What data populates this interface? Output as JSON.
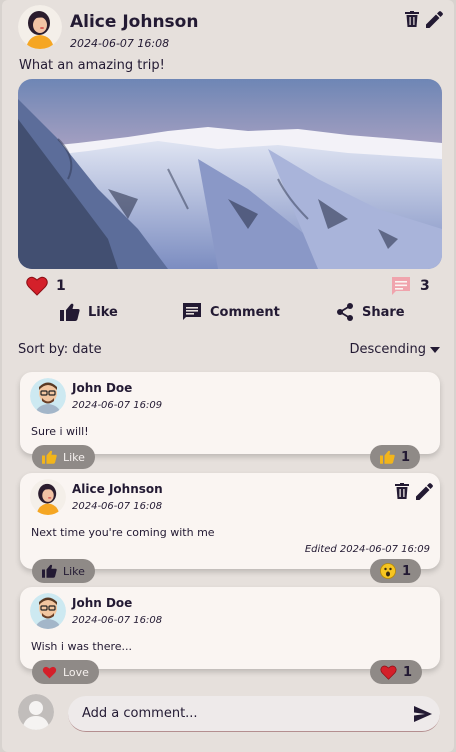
{
  "post": {
    "author": "Alice Johnson",
    "timestamp": "2024-06-07 16:08",
    "caption": "What an amazing trip!",
    "reactions_count": "1",
    "comments_count": "3",
    "actions": {
      "like": "Like",
      "comment": "Comment",
      "share": "Share"
    }
  },
  "sort": {
    "label": "Sort by: date",
    "order": "Descending"
  },
  "comments": [
    {
      "author": "John Doe",
      "timestamp": "2024-06-07 16:09",
      "text": "Sure i will!",
      "react_label": "Like",
      "react_count": "1",
      "react_icon": "thumbs-up-icon"
    },
    {
      "author": "Alice Johnson",
      "timestamp": "2024-06-07 16:08",
      "text": "Next time you're coming with me",
      "edited": "Edited 2024-06-07 16:09",
      "react_label": "Like",
      "react_count": "1",
      "react_icon": "surprised-face-icon"
    },
    {
      "author": "John Doe",
      "timestamp": "2024-06-07 16:08",
      "text": "Wish i was there...",
      "react_label": "Love",
      "react_count": "1",
      "react_icon": "heart-icon"
    }
  ],
  "composer": {
    "placeholder": "Add a comment..."
  },
  "colors": {
    "heart": "#d4202a",
    "thumb_yellow": "#f2b51b",
    "comment_icon_pink": "#f0a4ad",
    "ink": "#231a33"
  }
}
